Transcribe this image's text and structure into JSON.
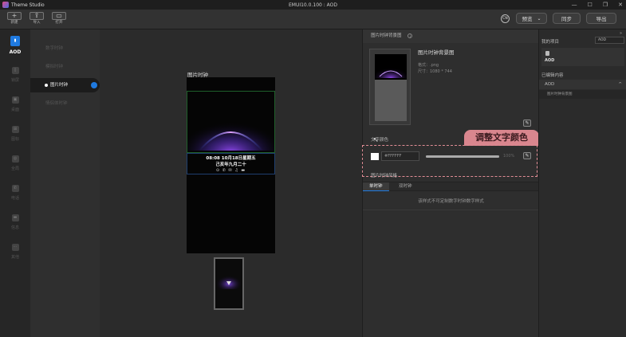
{
  "app": {
    "name": "Theme Studio",
    "window_title": "EMUI10.0.100 : AOD"
  },
  "window_controls": {
    "minimize": "—",
    "maximize": "☐",
    "restore": "❐",
    "close": "✕"
  },
  "toolbar": {
    "new_label": "新建",
    "import_label": "导入",
    "open_label": "打开",
    "lang": "CN",
    "preview_label": "预览",
    "preview_arrow": "⌄",
    "sync_label": "同步",
    "export_label": "导出"
  },
  "rail": {
    "items": [
      {
        "label": "AOD",
        "icon": "phone-icon"
      },
      {
        "label": "锁屏",
        "icon": "lock-icon"
      },
      {
        "label": "桌面",
        "icon": "home-icon"
      },
      {
        "label": "图标",
        "icon": "grid-icon"
      },
      {
        "label": "全局",
        "icon": "globe-icon"
      },
      {
        "label": "电话",
        "icon": "call-icon"
      },
      {
        "label": "信息",
        "icon": "message-icon"
      },
      {
        "label": "其他",
        "icon": "more-icon"
      }
    ]
  },
  "submenu": {
    "items": [
      {
        "label": "数字时钟"
      },
      {
        "label": "模拟时钟"
      },
      {
        "label": "图片时钟"
      },
      {
        "label": "情侣体时钟"
      }
    ]
  },
  "canvas": {
    "title": "图片时钟",
    "clock_line1": "08:08  10月18日星期五",
    "clock_line2": "己亥年九月二十",
    "status_icons": "⊙ ✆ ✉ ♫ ▬"
  },
  "props": {
    "header": "图片时钟背景图",
    "info_icon": "i",
    "bg_title": "图片时钟背景图",
    "bg_format": "格式：.png",
    "bg_size": "尺寸：1080 * 744",
    "text_color_label": "文字颜色",
    "hex_value": "#FFFFFF",
    "opacity_value": "100%",
    "opacity": 1.0,
    "callout": "调整文字颜色",
    "clock_style_label": "图片时钟风格",
    "tabs": [
      "单时钟",
      "双时钟"
    ],
    "tab_message": "该样式不可定制数字时钟数字样式",
    "edit_icon": "✎"
  },
  "project": {
    "title": "我的项目",
    "select_value": "AOD",
    "card_label": "AOD",
    "edited_header": "已编辑内容",
    "edited_row": "AOD",
    "edited_arrow": "^",
    "edited_sub": "图片时钟背景图",
    "collapse": "»"
  }
}
